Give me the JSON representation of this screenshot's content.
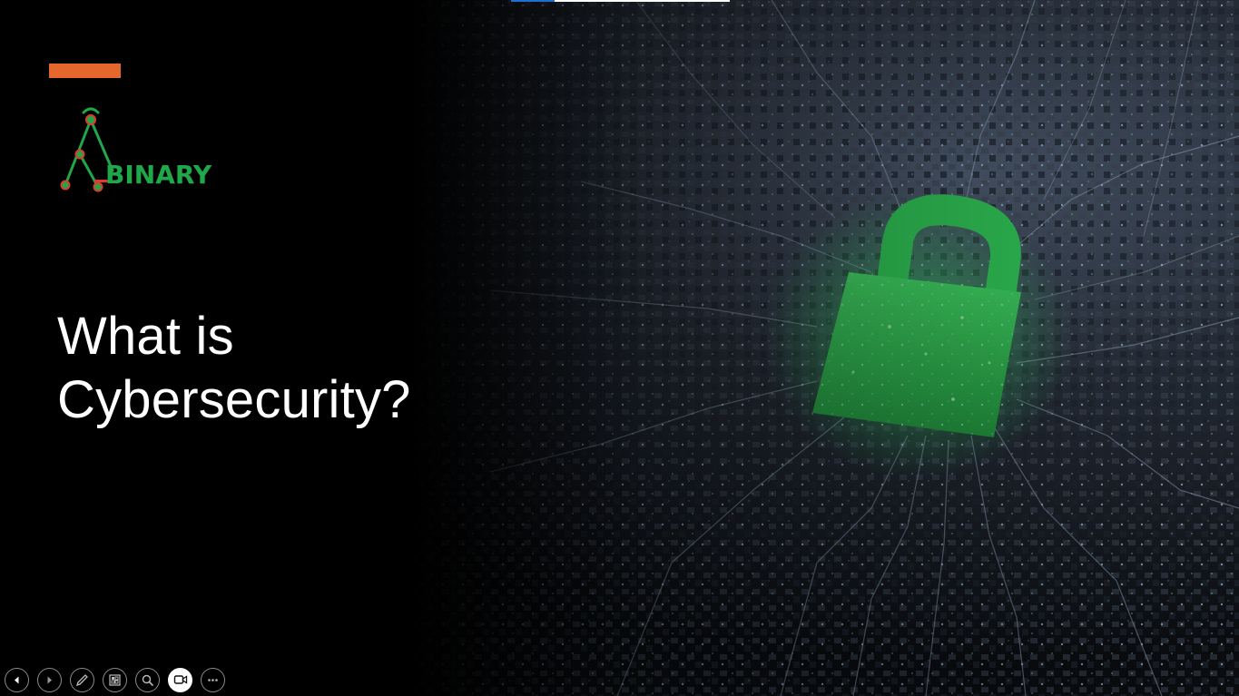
{
  "slide": {
    "title_line1": "What is",
    "title_line2": "Cybersecurity?",
    "logo_text": "BINARY",
    "accent_color": "#e5672b",
    "logo_color": "#1fa84a",
    "background_image": "circuit-board-padlock"
  },
  "top_progress": {
    "fraction": 0.2
  },
  "controls": [
    {
      "name": "previous-slide",
      "icon": "chevron-left-icon"
    },
    {
      "name": "next-slide",
      "icon": "chevron-right-icon"
    },
    {
      "name": "pen",
      "icon": "pen-icon"
    },
    {
      "name": "see-all-slides",
      "icon": "slides-grid-icon"
    },
    {
      "name": "zoom",
      "icon": "magnifier-icon"
    },
    {
      "name": "video",
      "icon": "video-camera-icon",
      "active": true
    },
    {
      "name": "more-options",
      "icon": "ellipsis-icon"
    }
  ]
}
